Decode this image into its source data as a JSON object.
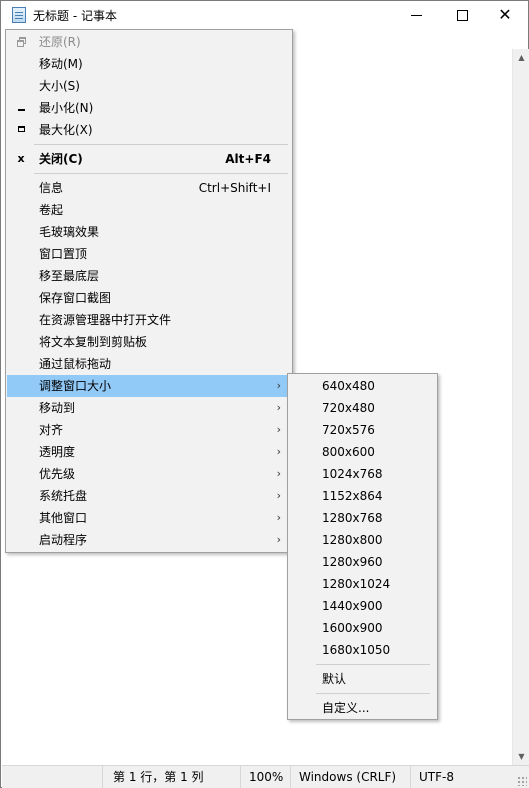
{
  "window": {
    "title": "无标题 - 记事本",
    "close_glyph": "✕"
  },
  "status": {
    "position": "第 1 行，第 1 列",
    "zoom": "100%",
    "line_ending": "Windows (CRLF)",
    "encoding": "UTF-8"
  },
  "menu": {
    "items": [
      {
        "label": "还原(R)",
        "icon": "restore-icon",
        "disabled": true
      },
      {
        "label": "移动(M)"
      },
      {
        "label": "大小(S)"
      },
      {
        "label": "最小化(N)",
        "icon": "minimize-icon"
      },
      {
        "label": "最大化(X)",
        "icon": "maximize-icon"
      },
      {
        "label": "关闭(C)",
        "accelerator": "Alt+F4",
        "icon": "close-icon",
        "icon_glyph": "x",
        "bold": true
      },
      {
        "label": "信息",
        "accelerator": "Ctrl+Shift+I"
      },
      {
        "label": "卷起"
      },
      {
        "label": "毛玻璃效果"
      },
      {
        "label": "窗口置顶"
      },
      {
        "label": "移至最底层"
      },
      {
        "label": "保存窗口截图"
      },
      {
        "label": "在资源管理器中打开文件"
      },
      {
        "label": "将文本复制到剪贴板"
      },
      {
        "label": "通过鼠标拖动"
      },
      {
        "label": "调整窗口大小",
        "submenu": true,
        "highlighted": true
      },
      {
        "label": "移动到",
        "submenu": true
      },
      {
        "label": "对齐",
        "submenu": true
      },
      {
        "label": "透明度",
        "submenu": true
      },
      {
        "label": "优先级",
        "submenu": true
      },
      {
        "label": "系统托盘",
        "submenu": true
      },
      {
        "label": "其他窗口",
        "submenu": true
      },
      {
        "label": "启动程序",
        "submenu": true
      }
    ],
    "submenu_arrow": "›"
  },
  "submenu": {
    "items": [
      {
        "label": "640x480"
      },
      {
        "label": "720x480"
      },
      {
        "label": "720x576"
      },
      {
        "label": "800x600"
      },
      {
        "label": "1024x768"
      },
      {
        "label": "1152x864"
      },
      {
        "label": "1280x768"
      },
      {
        "label": "1280x800"
      },
      {
        "label": "1280x960"
      },
      {
        "label": "1280x1024"
      },
      {
        "label": "1440x900"
      },
      {
        "label": "1600x900"
      },
      {
        "label": "1680x1050"
      },
      {
        "label": "默认"
      },
      {
        "label": "自定义..."
      }
    ]
  }
}
